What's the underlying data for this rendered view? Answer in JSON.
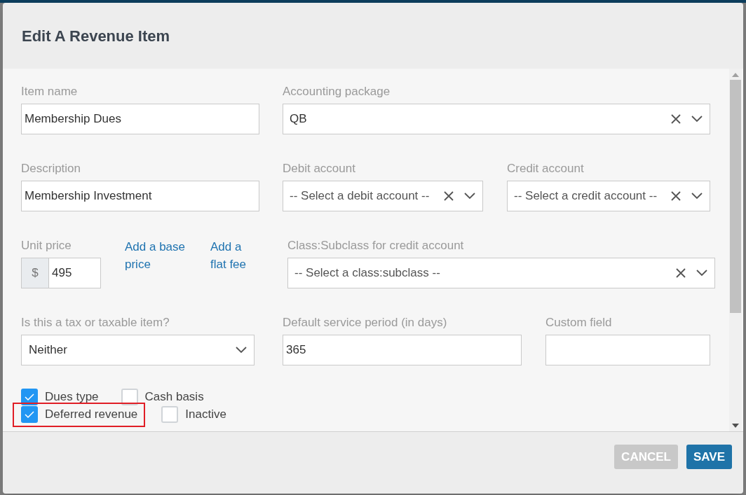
{
  "dialog": {
    "title": "Edit A Revenue Item"
  },
  "item_name": {
    "label": "Item name",
    "value": "Membership Dues"
  },
  "accounting_package": {
    "label": "Accounting package",
    "value": "QB"
  },
  "description": {
    "label": "Description",
    "value": "Membership Investment"
  },
  "debit_account": {
    "label": "Debit account",
    "placeholder": "-- Select a debit account --"
  },
  "credit_account": {
    "label": "Credit account",
    "placeholder": "-- Select a credit account --"
  },
  "unit_price": {
    "label": "Unit price",
    "currency": "$",
    "value": "495"
  },
  "links": [
    "Add a base price",
    "Add a flat fee"
  ],
  "class_subclass": {
    "label": "Class:Subclass for credit account",
    "placeholder": "-- Select a class:subclass --"
  },
  "tax": {
    "label": "Is this a tax or taxable item?",
    "value": "Neither"
  },
  "service_period": {
    "label": "Default service period (in days)",
    "value": "365"
  },
  "custom_field": {
    "label": "Custom field"
  },
  "checkboxes": [
    {
      "label": "Dues type",
      "checked": true,
      "highlighted": false
    },
    {
      "label": "Cash basis",
      "checked": false,
      "highlighted": false
    },
    {
      "label": "Deferred revenue",
      "checked": true,
      "highlighted": true
    },
    {
      "label": "Inactive",
      "checked": false,
      "highlighted": false
    }
  ],
  "buttons": [
    {
      "label": "CANCEL",
      "disabled": true
    },
    {
      "label": "SAVE",
      "disabled": false
    }
  ]
}
